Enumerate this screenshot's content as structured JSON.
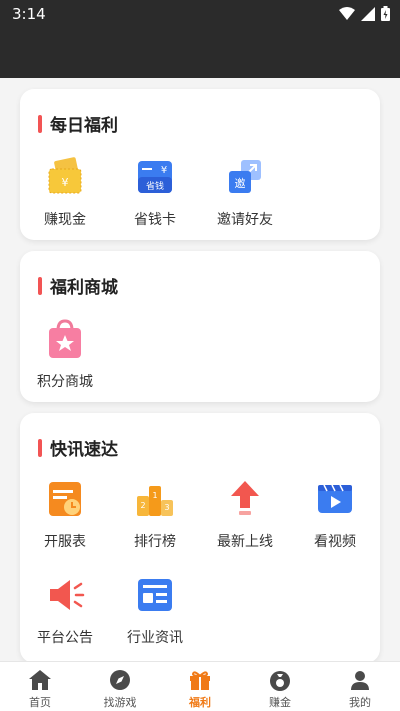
{
  "status": {
    "time": "3:14"
  },
  "sections": [
    {
      "title": "每日福利",
      "items": [
        {
          "label": "赚现金",
          "icon": "cash-tickets-icon"
        },
        {
          "label": "省钱卡",
          "icon": "saving-card-icon",
          "badge": "省钱"
        },
        {
          "label": "邀请好友",
          "icon": "invite-icon",
          "badge": "邀"
        }
      ]
    },
    {
      "title": "福利商城",
      "items": [
        {
          "label": "积分商城",
          "icon": "shopping-bag-icon"
        }
      ]
    },
    {
      "title": "快讯速达",
      "items": [
        {
          "label": "开服表",
          "icon": "server-schedule-icon"
        },
        {
          "label": "排行榜",
          "icon": "podium-icon"
        },
        {
          "label": "最新上线",
          "icon": "arrow-up-icon"
        },
        {
          "label": "看视频",
          "icon": "video-icon"
        },
        {
          "label": "平台公告",
          "icon": "megaphone-icon"
        },
        {
          "label": "行业资讯",
          "icon": "news-icon"
        }
      ]
    }
  ],
  "tabs": [
    {
      "label": "首页",
      "icon": "home-icon"
    },
    {
      "label": "找游戏",
      "icon": "compass-icon"
    },
    {
      "label": "福利",
      "icon": "gift-icon",
      "active": true
    },
    {
      "label": "赚金",
      "icon": "money-bag-icon"
    },
    {
      "label": "我的",
      "icon": "user-icon"
    }
  ],
  "colors": {
    "accent": "#f07a17",
    "title_bar": "#f25454"
  }
}
